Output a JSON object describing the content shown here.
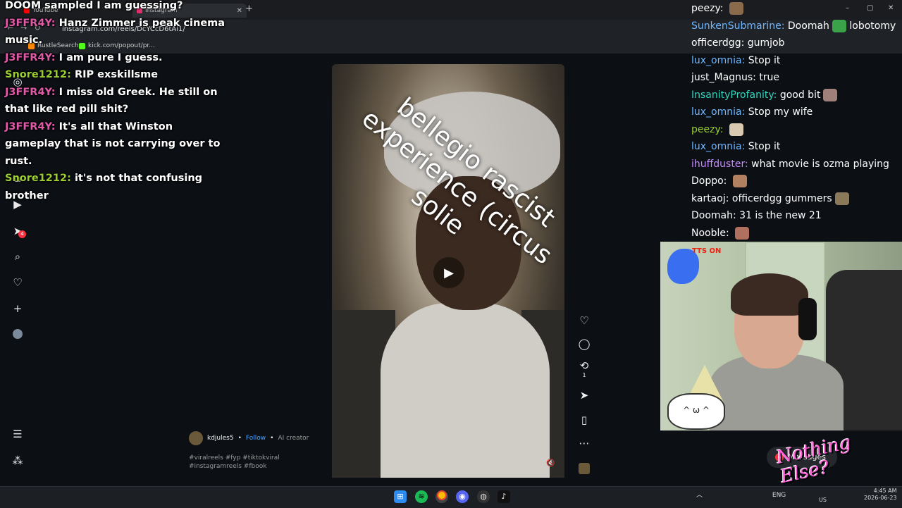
{
  "browser": {
    "tabs": [
      {
        "label": "YouTube",
        "favicon_color": "#ff0000"
      },
      {
        "label": "Instagram",
        "favicon_color": "#e1306c"
      }
    ],
    "new_tab_symbol": "+",
    "url": "instagram.com/reels/DcYCcD6tAi1/",
    "bookmarks": [
      {
        "label": "RustleSearch",
        "color": "#ff8a00"
      },
      {
        "label": "kick.com/popout/pr...",
        "color": "#53fc18"
      }
    ],
    "window_controls": [
      "–",
      "▢",
      "✕"
    ]
  },
  "left_chat": [
    {
      "user": "",
      "text": "DOOM sampled I am guessing?",
      "color": "#ffffff"
    },
    {
      "user": "J3FFR4Y:",
      "text": "Hanz Zimmer is peak cinema music.",
      "color": "#e05aa8"
    },
    {
      "user": "J3FFR4Y:",
      "text": "I am pure I guess.",
      "color": "#e05aa8"
    },
    {
      "user": "Snore1212:",
      "text": "RIP exskillsme",
      "color": "#9acd32"
    },
    {
      "user": "J3FFR4Y:",
      "text": "I miss old Greek. He still on that like red pill shit?",
      "color": "#e05aa8"
    },
    {
      "user": "J3FFR4Y:",
      "text": "It's all that Winston gameplay that is not carrying over to rust.",
      "color": "#e05aa8"
    },
    {
      "user": "Snore1212:",
      "text": "it's not that confusing brother",
      "color": "#9acd32"
    }
  ],
  "reel": {
    "caption_overlay": "bellegio rascist experience (circus solie",
    "author": "kdjules5",
    "follow_label": "Follow",
    "author_subtitle": "AI creator",
    "hashtags": "#viralreels #fyp #tiktokviral #instagramreels #fbook",
    "repost_count": "1"
  },
  "right_chat": [
    {
      "user": "peezy:",
      "color": "#ffffff",
      "text": "",
      "emote": "#8a6a4a"
    },
    {
      "user": "SunkenSubmarine:",
      "color": "#6fb7ff",
      "text": "Doomah",
      "emote": "#3aa34a",
      "suffix": "lobotomy"
    },
    {
      "user": "officerdgg:",
      "color": "#ffffff",
      "text": "gumjob"
    },
    {
      "user": "lux_omnia:",
      "color": "#6fb7ff",
      "text": "Stop it"
    },
    {
      "user": "just_Magnus:",
      "color": "#ffffff",
      "text": "true"
    },
    {
      "user": "InsanityProfanity:",
      "color": "#30d8c0",
      "text": "good bit",
      "emote": "#a0807a"
    },
    {
      "user": "lux_omnia:",
      "color": "#6fb7ff",
      "text": "Stop my wife"
    },
    {
      "user": "peezy:",
      "color": "#9acd32",
      "text": "",
      "emote": "#d9c9b0"
    },
    {
      "user": "lux_omnia:",
      "color": "#6fb7ff",
      "text": "Stop it"
    },
    {
      "user": "ihuffduster:",
      "color": "#c58bff",
      "text": "what movie is ozma playing"
    },
    {
      "user": "Doppo:",
      "color": "#ffffff",
      "text": "",
      "emote": "#b08060"
    },
    {
      "user": "kartaoj:",
      "color": "#ffffff",
      "text": "officerdgg gummers",
      "emote": "#8a7a5a"
    },
    {
      "user": "Doomah:",
      "color": "#ffffff",
      "text": "31 is the new 21"
    },
    {
      "user": "Nooble:",
      "color": "#ffffff",
      "text": "",
      "emote": "#b07060"
    }
  ],
  "webcam": {
    "tts_badge": "TTS ON"
  },
  "overlay": {
    "messages_label": "Messages",
    "messages_badge": "4",
    "brand_text": "Nothing Else?"
  },
  "sidebar": {
    "notification_badge": "4"
  },
  "taskbar": {
    "lang": "ENG",
    "region": "US",
    "time": "4:45 AM",
    "date": "2026-06-23"
  }
}
